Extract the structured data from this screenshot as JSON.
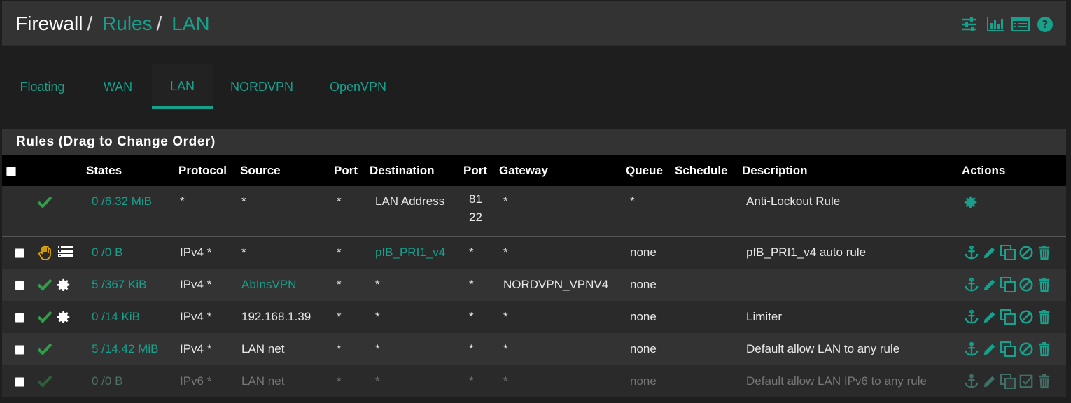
{
  "breadcrumb": {
    "part1": "Firewall",
    "sep": "/",
    "part2": "Rules",
    "part3": "LAN"
  },
  "header_icons": [
    "sliders-icon",
    "bar-chart-icon",
    "list-icon",
    "help-icon"
  ],
  "tabs": [
    {
      "label": "Floating",
      "active": false
    },
    {
      "label": "WAN",
      "active": false
    },
    {
      "label": "LAN",
      "active": true
    },
    {
      "label": "NORDVPN",
      "active": false
    },
    {
      "label": "OpenVPN",
      "active": false
    }
  ],
  "panel": {
    "title": "Rules (Drag to Change Order)"
  },
  "columns": {
    "states": "States",
    "protocol": "Protocol",
    "source": "Source",
    "port": "Port",
    "destination": "Destination",
    "dport": "Port",
    "gateway": "Gateway",
    "queue": "Queue",
    "schedule": "Schedule",
    "description": "Description",
    "actions": "Actions"
  },
  "rows": [
    {
      "states": "0 /6.32 MiB",
      "protocol": "*",
      "source": "*",
      "port": "*",
      "destination": "LAN Address",
      "dport": "81",
      "dport2": "22",
      "gateway": "*",
      "queue": "*",
      "schedule": "",
      "description": "Anti-Lockout Rule"
    },
    {
      "states": "0 /0 B",
      "protocol": "IPv4 *",
      "source": "*",
      "port": "*",
      "destination": "pfB_PRI1_v4",
      "dport": "*",
      "gateway": "*",
      "queue": "none",
      "schedule": "",
      "description": "pfB_PRI1_v4 auto rule"
    },
    {
      "states": "5 /367 KiB",
      "protocol": "IPv4 *",
      "source": "AbInsVPN",
      "port": "*",
      "destination": "*",
      "dport": "*",
      "gateway": "NORDVPN_VPNV4",
      "queue": "none",
      "schedule": "",
      "description": ""
    },
    {
      "states": "0 /14 KiB",
      "protocol": "IPv4 *",
      "source": "192.168.1.39",
      "port": "*",
      "destination": "*",
      "dport": "*",
      "gateway": "*",
      "queue": "none",
      "schedule": "",
      "description": "Limiter"
    },
    {
      "states": "5 /14.42 MiB",
      "protocol": "IPv4 *",
      "source": "LAN net",
      "port": "*",
      "destination": "*",
      "dport": "*",
      "gateway": "*",
      "queue": "none",
      "schedule": "",
      "description": "Default allow LAN to any rule"
    },
    {
      "states": "0 /0 B",
      "protocol": "IPv6 *",
      "source": "LAN net",
      "port": "*",
      "destination": "*",
      "dport": "*",
      "gateway": "*",
      "queue": "none",
      "schedule": "",
      "description": "Default allow LAN IPv6 to any rule"
    }
  ],
  "colors": {
    "accent": "#17a08c",
    "pass": "#2e9e4a",
    "block_hand": "#e0a800"
  }
}
